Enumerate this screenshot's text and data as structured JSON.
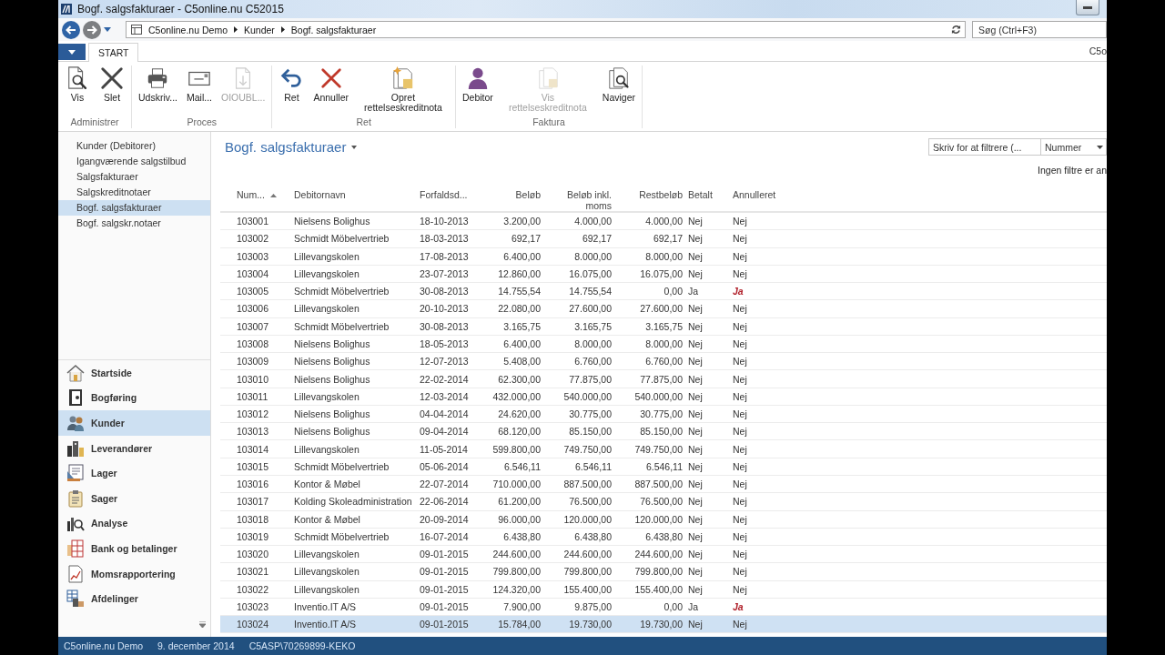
{
  "window": {
    "title": "Bogf. salgsfakturaer - C5online.nu C52015"
  },
  "navigation": {
    "breadcrumb": [
      "C5online.nu Demo",
      "Kunder",
      "Bogf. salgsfakturaer"
    ],
    "search": {
      "placeholder": "Søg (Ctrl+F3)"
    }
  },
  "ribbon": {
    "tabs": [
      {
        "label": "START",
        "selected": true
      }
    ],
    "company": "C5o",
    "groups": [
      {
        "label": "Administrer",
        "buttons": [
          {
            "label": "Vis",
            "disabled": false
          },
          {
            "label": "Slet",
            "disabled": false
          }
        ]
      },
      {
        "label": "Proces",
        "buttons": [
          {
            "label": "Udskriv...",
            "disabled": false
          },
          {
            "label": "Mail...",
            "disabled": false
          },
          {
            "label": "OIOUBL...",
            "disabled": true
          }
        ]
      },
      {
        "label": "Ret",
        "buttons": [
          {
            "label": "Ret",
            "disabled": false
          },
          {
            "label": "Annuller",
            "disabled": false
          },
          {
            "label": "Opret rettelseskreditnota",
            "disabled": false
          }
        ]
      },
      {
        "label": "Faktura",
        "buttons": [
          {
            "label": "Debitor",
            "disabled": false
          },
          {
            "label": "Vis rettelseskreditnota",
            "disabled": true
          },
          {
            "label": "Naviger",
            "disabled": false
          }
        ]
      }
    ]
  },
  "sidebar": {
    "links": [
      {
        "label": "Kunder (Debitorer)",
        "selected": false
      },
      {
        "label": "Igangværende salgstilbud",
        "selected": false
      },
      {
        "label": "Salgsfakturaer",
        "selected": false
      },
      {
        "label": "Salgskreditnotaer",
        "selected": false
      },
      {
        "label": "Bogf. salgsfakturaer",
        "selected": true
      },
      {
        "label": "Bogf. salgskr.notaer",
        "selected": false
      }
    ],
    "sections": [
      {
        "label": "Startside",
        "selected": false
      },
      {
        "label": "Bogføring",
        "selected": false
      },
      {
        "label": "Kunder",
        "selected": true
      },
      {
        "label": "Leverandører",
        "selected": false
      },
      {
        "label": "Lager",
        "selected": false
      },
      {
        "label": "Sager",
        "selected": false
      },
      {
        "label": "Analyse",
        "selected": false
      },
      {
        "label": "Bank og betalinger",
        "selected": false
      },
      {
        "label": "Momsrapportering",
        "selected": false
      },
      {
        "label": "Afdelinger",
        "selected": false
      }
    ]
  },
  "page": {
    "title": "Bogf. salgsfakturaer",
    "filter": {
      "placeholder": "Skriv for at filtrere (...",
      "field": "Nummer"
    },
    "filter_status": "Ingen filtre er an"
  },
  "table": {
    "columns": [
      {
        "label": "Num...",
        "kind": "number",
        "sorted": true
      },
      {
        "label": "Debitornavn",
        "kind": "text",
        "sorted": false
      },
      {
        "label": "Forfaldsd...",
        "kind": "date",
        "sorted": false
      },
      {
        "label": "Beløb",
        "kind": "amount",
        "sorted": false
      },
      {
        "label": "Beløb inkl. moms",
        "kind": "amount",
        "sorted": false
      },
      {
        "label": "Restbeløb",
        "kind": "amount",
        "sorted": false
      },
      {
        "label": "Betalt",
        "kind": "flag",
        "sorted": false
      },
      {
        "label": "Annulleret",
        "kind": "status",
        "sorted": false
      }
    ],
    "rows": [
      {
        "cells": [
          "103001",
          "Nielsens Bolighus",
          "18-10-2013",
          "3.200,00",
          "4.000,00",
          "4.000,00",
          "Nej",
          "Nej"
        ],
        "cancelled": false,
        "selected": false
      },
      {
        "cells": [
          "103002",
          "Schmidt Möbelvertrieb",
          "18-03-2013",
          "692,17",
          "692,17",
          "692,17",
          "Nej",
          "Nej"
        ],
        "cancelled": false,
        "selected": false
      },
      {
        "cells": [
          "103003",
          "Lillevangskolen",
          "17-08-2013",
          "6.400,00",
          "8.000,00",
          "8.000,00",
          "Nej",
          "Nej"
        ],
        "cancelled": false,
        "selected": false
      },
      {
        "cells": [
          "103004",
          "Lillevangskolen",
          "23-07-2013",
          "12.860,00",
          "16.075,00",
          "16.075,00",
          "Nej",
          "Nej"
        ],
        "cancelled": false,
        "selected": false
      },
      {
        "cells": [
          "103005",
          "Schmidt Möbelvertrieb",
          "30-08-2013",
          "14.755,54",
          "14.755,54",
          "0,00",
          "Ja",
          "Ja"
        ],
        "cancelled": true,
        "selected": false
      },
      {
        "cells": [
          "103006",
          "Lillevangskolen",
          "20-10-2013",
          "22.080,00",
          "27.600,00",
          "27.600,00",
          "Nej",
          "Nej"
        ],
        "cancelled": false,
        "selected": false
      },
      {
        "cells": [
          "103007",
          "Schmidt Möbelvertrieb",
          "30-08-2013",
          "3.165,75",
          "3.165,75",
          "3.165,75",
          "Nej",
          "Nej"
        ],
        "cancelled": false,
        "selected": false
      },
      {
        "cells": [
          "103008",
          "Nielsens Bolighus",
          "18-05-2013",
          "6.400,00",
          "8.000,00",
          "8.000,00",
          "Nej",
          "Nej"
        ],
        "cancelled": false,
        "selected": false
      },
      {
        "cells": [
          "103009",
          "Nielsens Bolighus",
          "12-07-2013",
          "5.408,00",
          "6.760,00",
          "6.760,00",
          "Nej",
          "Nej"
        ],
        "cancelled": false,
        "selected": false
      },
      {
        "cells": [
          "103010",
          "Nielsens Bolighus",
          "22-02-2014",
          "62.300,00",
          "77.875,00",
          "77.875,00",
          "Nej",
          "Nej"
        ],
        "cancelled": false,
        "selected": false
      },
      {
        "cells": [
          "103011",
          "Lillevangskolen",
          "12-03-2014",
          "432.000,00",
          "540.000,00",
          "540.000,00",
          "Nej",
          "Nej"
        ],
        "cancelled": false,
        "selected": false
      },
      {
        "cells": [
          "103012",
          "Nielsens Bolighus",
          "04-04-2014",
          "24.620,00",
          "30.775,00",
          "30.775,00",
          "Nej",
          "Nej"
        ],
        "cancelled": false,
        "selected": false
      },
      {
        "cells": [
          "103013",
          "Nielsens Bolighus",
          "09-04-2014",
          "68.120,00",
          "85.150,00",
          "85.150,00",
          "Nej",
          "Nej"
        ],
        "cancelled": false,
        "selected": false
      },
      {
        "cells": [
          "103014",
          "Lillevangskolen",
          "11-05-2014",
          "599.800,00",
          "749.750,00",
          "749.750,00",
          "Nej",
          "Nej"
        ],
        "cancelled": false,
        "selected": false
      },
      {
        "cells": [
          "103015",
          "Schmidt Möbelvertrieb",
          "05-06-2014",
          "6.546,11",
          "6.546,11",
          "6.546,11",
          "Nej",
          "Nej"
        ],
        "cancelled": false,
        "selected": false
      },
      {
        "cells": [
          "103016",
          "Kontor & Møbel",
          "22-07-2014",
          "710.000,00",
          "887.500,00",
          "887.500,00",
          "Nej",
          "Nej"
        ],
        "cancelled": false,
        "selected": false
      },
      {
        "cells": [
          "103017",
          "Kolding Skoleadministration",
          "22-06-2014",
          "61.200,00",
          "76.500,00",
          "76.500,00",
          "Nej",
          "Nej"
        ],
        "cancelled": false,
        "selected": false
      },
      {
        "cells": [
          "103018",
          "Kontor & Møbel",
          "20-09-2014",
          "96.000,00",
          "120.000,00",
          "120.000,00",
          "Nej",
          "Nej"
        ],
        "cancelled": false,
        "selected": false
      },
      {
        "cells": [
          "103019",
          "Schmidt Möbelvertrieb",
          "16-07-2014",
          "6.438,80",
          "6.438,80",
          "6.438,80",
          "Nej",
          "Nej"
        ],
        "cancelled": false,
        "selected": false
      },
      {
        "cells": [
          "103020",
          "Lillevangskolen",
          "09-01-2015",
          "244.600,00",
          "244.600,00",
          "244.600,00",
          "Nej",
          "Nej"
        ],
        "cancelled": false,
        "selected": false
      },
      {
        "cells": [
          "103021",
          "Lillevangskolen",
          "09-01-2015",
          "799.800,00",
          "799.800,00",
          "799.800,00",
          "Nej",
          "Nej"
        ],
        "cancelled": false,
        "selected": false
      },
      {
        "cells": [
          "103022",
          "Lillevangskolen",
          "09-01-2015",
          "124.320,00",
          "155.400,00",
          "155.400,00",
          "Nej",
          "Nej"
        ],
        "cancelled": false,
        "selected": false
      },
      {
        "cells": [
          "103023",
          "Inventio.IT A/S",
          "09-01-2015",
          "7.900,00",
          "9.875,00",
          "0,00",
          "Ja",
          "Ja"
        ],
        "cancelled": true,
        "selected": false
      },
      {
        "cells": [
          "103024",
          "Inventio.IT A/S",
          "09-01-2015",
          "15.784,00",
          "19.730,00",
          "19.730,00",
          "Nej",
          "Nej"
        ],
        "cancelled": false,
        "selected": true
      }
    ]
  },
  "status_bar": [
    "C5online.nu Demo",
    "9. december 2014",
    "C5ASP\\70269899-KEKO"
  ]
}
